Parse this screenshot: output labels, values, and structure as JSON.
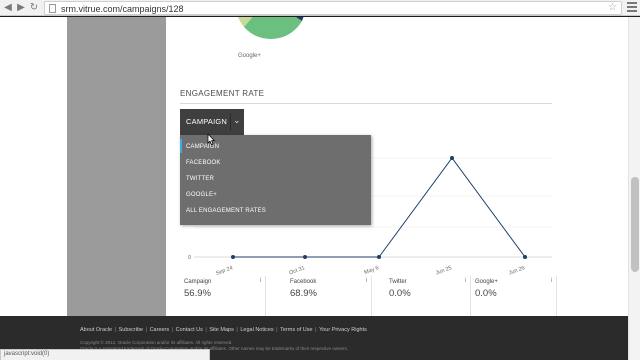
{
  "browser": {
    "url": "srm.vitrue.com/campaigns/128"
  },
  "pie": {
    "legend_label": "Google+"
  },
  "engagement": {
    "title": "ENGAGEMENT RATE",
    "selected": "CAMPAIGN",
    "dropdown_options": [
      "CAMPAIGN",
      "FACEBOOK",
      "TWITTER",
      "GOOGLE+",
      "ALL ENGAGEMENT RATES"
    ]
  },
  "chart_data": {
    "type": "line",
    "x": [
      "Sep 24",
      "Oct 31",
      "May 6",
      "Jun 25",
      "Jun 26"
    ],
    "values": [
      0,
      0,
      0,
      1,
      0
    ],
    "y_tick_label": "0",
    "color": "#1d3f66"
  },
  "stats": [
    {
      "name": "Campaign",
      "value": "56.9%",
      "info": "i"
    },
    {
      "name": "Facebook",
      "value": "68.9%",
      "info": "i"
    },
    {
      "name": "Twitter",
      "value": "0.0%",
      "info": "i"
    },
    {
      "name": "Google+",
      "value": "0.0%",
      "info": "i"
    }
  ],
  "footer": {
    "links": [
      "About Oracle",
      "Subscribe",
      "Careers",
      "Contact Us",
      "Site Maps",
      "Legal Notices",
      "Terms of Use",
      "Your Privacy Rights"
    ],
    "copyright_line1": "Copyright © 2012, Oracle Corporation and/or its affiliates. All rights reserved.",
    "copyright_line2": "Oracle is a registered trademark of Oracle Corporation and/or its affiliates. Other names may be trademarks of their respective owners."
  },
  "status_bar": "javascript:void(0)"
}
